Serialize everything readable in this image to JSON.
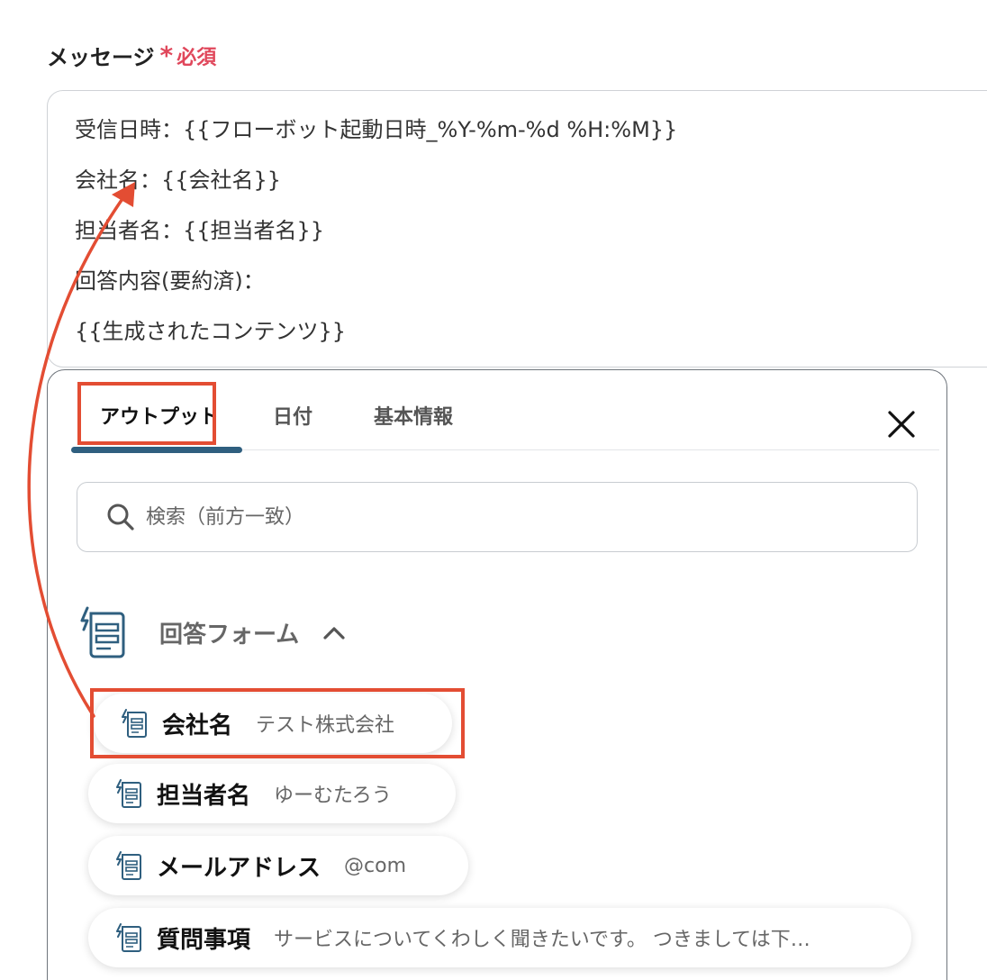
{
  "field": {
    "label": "メッセージ",
    "required_mark": "*",
    "required_text": "必須"
  },
  "message": {
    "lines": [
      "受信日時：{{フローボット起動日時_%Y-%m-%d %H:%M}}",
      "会社名：{{会社名}}",
      "担当者名：{{担当者名}}",
      "回答内容(要約済)：",
      "{{生成されたコンテンツ}}"
    ]
  },
  "tabs": [
    {
      "label": "アウトプット",
      "active": true
    },
    {
      "label": "日付",
      "active": false
    },
    {
      "label": "基本情報",
      "active": false
    }
  ],
  "search": {
    "placeholder": "検索（前方一致）",
    "value": ""
  },
  "group": {
    "title": "回答フォーム",
    "expanded": true
  },
  "outputs": [
    {
      "name": "会社名",
      "value": "テスト株式会社"
    },
    {
      "name": "担当者名",
      "value": "ゆーむたろう"
    },
    {
      "name": "メールアドレス",
      "value": "@com"
    },
    {
      "name": "質問事項",
      "value": "サービスについてくわしく聞きたいです。 つきましては下…"
    }
  ],
  "colors": {
    "required": "#e0475b",
    "accent": "#2f5f7f",
    "annotation": "#e34d33",
    "icon": "#2f5f7f"
  },
  "icons": [
    "close-icon",
    "search-icon",
    "form-icon",
    "chevron-up-icon",
    "arrow"
  ]
}
